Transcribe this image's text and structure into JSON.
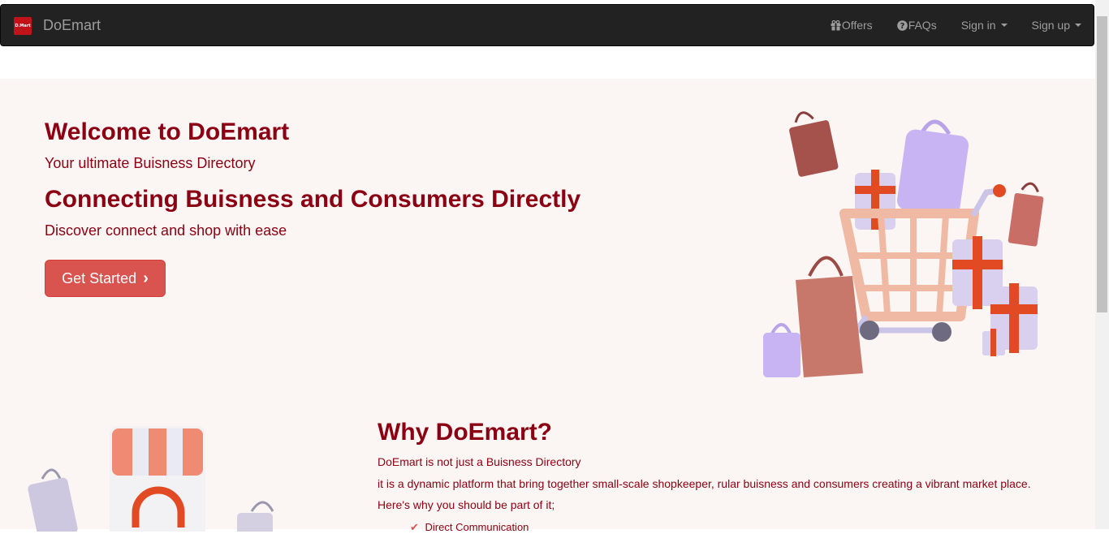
{
  "navbar": {
    "logo_text": "D.Mart",
    "brand": "DoEmart",
    "items": [
      {
        "label": "Offers",
        "icon": "gift-icon"
      },
      {
        "label": "FAQs",
        "icon": "question-circle-icon"
      },
      {
        "label": "Sign in",
        "dropdown": true
      },
      {
        "label": "Sign up",
        "dropdown": true
      }
    ]
  },
  "hero": {
    "title": "Welcome to DoEmart",
    "subtitle": "Your ultimate Buisness Directory",
    "title2": "Connecting Buisness and Consumers Directly",
    "subtitle2": "Discover connect and shop with ease",
    "cta_label": "Get Started"
  },
  "why": {
    "title": "Why DoEmart?",
    "p1": "DoEmart is not just a Buisness Directory",
    "p2": "it is a dynamic platform that bring together small-scale shopkeeper, rular buisness and consumers creating a vibrant market place.",
    "p3": "Here's why you should be part of it;",
    "list": [
      "Direct Communication"
    ]
  },
  "colors": {
    "accent": "#8b0012",
    "button": "#d9534f",
    "navbar": "#222222",
    "hero_bg": "#fbf5f3"
  }
}
